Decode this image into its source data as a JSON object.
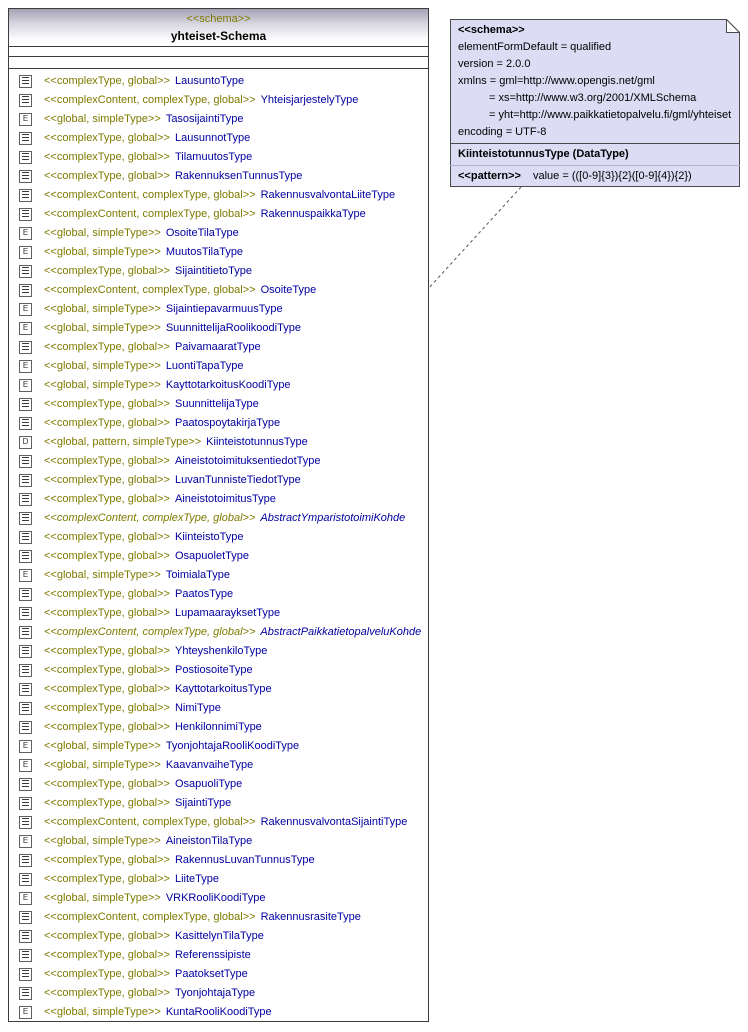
{
  "colors": {
    "stereotype_olive": "#7e7a00",
    "type_name_navy": "#0000a0",
    "note_background": "#dcdcf5",
    "header_gradient_top": "#a5a1b4"
  },
  "schema_box": {
    "stereotype": "<<schema>>",
    "title": "yhteiset-Schema",
    "rows": [
      {
        "icon": "complex",
        "icon_name": "complextype-icon",
        "glyph": "",
        "stereotype": "<<complexType, global>>",
        "name": "LausuntoType"
      },
      {
        "icon": "complex",
        "icon_name": "complextype-icon",
        "glyph": "",
        "stereotype": "<<complexContent, complexType, global>>",
        "name": "YhteisjarjestelyType"
      },
      {
        "icon": "enum",
        "icon_name": "enum-simpletype-icon",
        "glyph": "E",
        "stereotype": "<<global, simpleType>>",
        "name": "TasosijaintiType"
      },
      {
        "icon": "complex",
        "icon_name": "complextype-icon",
        "glyph": "",
        "stereotype": "<<complexType, global>>",
        "name": "LausunnotType"
      },
      {
        "icon": "complex",
        "icon_name": "complextype-icon",
        "glyph": "",
        "stereotype": "<<complexType, global>>",
        "name": "TilamuutosType"
      },
      {
        "icon": "complex",
        "icon_name": "complextype-icon",
        "glyph": "",
        "stereotype": "<<complexType, global>>",
        "name": "RakennuksenTunnusType"
      },
      {
        "icon": "complex",
        "icon_name": "complextype-icon",
        "glyph": "",
        "stereotype": "<<complexContent, complexType, global>>",
        "name": "RakennusvalvontaLiiteType"
      },
      {
        "icon": "complex",
        "icon_name": "complextype-icon",
        "glyph": "",
        "stereotype": "<<complexContent, complexType, global>>",
        "name": "RakennuspaikkaType"
      },
      {
        "icon": "enum",
        "icon_name": "enum-simpletype-icon",
        "glyph": "E",
        "stereotype": "<<global, simpleType>>",
        "name": "OsoiteTilaType"
      },
      {
        "icon": "enum",
        "icon_name": "enum-simpletype-icon",
        "glyph": "E",
        "stereotype": "<<global, simpleType>>",
        "name": "MuutosTilaType"
      },
      {
        "icon": "complex",
        "icon_name": "complextype-icon",
        "glyph": "",
        "stereotype": "<<complexType, global>>",
        "name": "SijaintitietoType"
      },
      {
        "icon": "complex",
        "icon_name": "complextype-icon",
        "glyph": "",
        "stereotype": "<<complexContent, complexType, global>>",
        "name": "OsoiteType"
      },
      {
        "icon": "enum",
        "icon_name": "enum-simpletype-icon",
        "glyph": "E",
        "stereotype": "<<global, simpleType>>",
        "name": "SijaintiepavarmuusType"
      },
      {
        "icon": "enum",
        "icon_name": "enum-simpletype-icon",
        "glyph": "E",
        "stereotype": "<<global, simpleType>>",
        "name": "SuunnittelijaRoolikoodiType"
      },
      {
        "icon": "complex",
        "icon_name": "complextype-icon",
        "glyph": "",
        "stereotype": "<<complexType, global>>",
        "name": "PaivamaaratType"
      },
      {
        "icon": "enum",
        "icon_name": "enum-simpletype-icon",
        "glyph": "E",
        "stereotype": "<<global, simpleType>>",
        "name": "LuontiTapaType"
      },
      {
        "icon": "enum",
        "icon_name": "enum-simpletype-icon",
        "glyph": "E",
        "stereotype": "<<global, simpleType>>",
        "name": "KayttotarkoitusKoodiType"
      },
      {
        "icon": "complex",
        "icon_name": "complextype-icon",
        "glyph": "",
        "stereotype": "<<complexType, global>>",
        "name": "SuunnittelijaType"
      },
      {
        "icon": "complex",
        "icon_name": "complextype-icon",
        "glyph": "",
        "stereotype": "<<complexType, global>>",
        "name": "PaatospoytakirjaType"
      },
      {
        "icon": "pattern",
        "icon_name": "pattern-simpletype-icon",
        "glyph": "D",
        "stereotype": "<<global, pattern, simpleType>>",
        "name": "KiinteistotunnusType"
      },
      {
        "icon": "complex",
        "icon_name": "complextype-icon",
        "glyph": "",
        "stereotype": "<<complexType, global>>",
        "name": "AineistotoimituksentiedotType"
      },
      {
        "icon": "complex",
        "icon_name": "complextype-icon",
        "glyph": "",
        "stereotype": "<<complexType, global>>",
        "name": "LuvanTunnisteTiedotType"
      },
      {
        "icon": "complex",
        "icon_name": "complextype-icon",
        "glyph": "",
        "stereotype": "<<complexType, global>>",
        "name": "AineistotoimitusType"
      },
      {
        "icon": "complex",
        "icon_name": "complextype-icon",
        "glyph": "",
        "stereotype": "<<complexContent, complexType, global>>",
        "name": "AbstractYmparistotoimiKohde",
        "abstract": true
      },
      {
        "icon": "complex",
        "icon_name": "complextype-icon",
        "glyph": "",
        "stereotype": "<<complexType, global>>",
        "name": "KiinteistoType"
      },
      {
        "icon": "complex",
        "icon_name": "complextype-icon",
        "glyph": "",
        "stereotype": "<<complexType, global>>",
        "name": "OsapuoletType"
      },
      {
        "icon": "enum",
        "icon_name": "enum-simpletype-icon",
        "glyph": "E",
        "stereotype": "<<global, simpleType>>",
        "name": "ToimialaType"
      },
      {
        "icon": "complex",
        "icon_name": "complextype-icon",
        "glyph": "",
        "stereotype": "<<complexType, global>>",
        "name": "PaatosType"
      },
      {
        "icon": "complex",
        "icon_name": "complextype-icon",
        "glyph": "",
        "stereotype": "<<complexType, global>>",
        "name": "LupamaarayksetType"
      },
      {
        "icon": "complex",
        "icon_name": "complextype-icon",
        "glyph": "",
        "stereotype": "<<complexContent, complexType, global>>",
        "name": "AbstractPaikkatietopalveluKohde",
        "abstract": true
      },
      {
        "icon": "complex",
        "icon_name": "complextype-icon",
        "glyph": "",
        "stereotype": "<<complexType, global>>",
        "name": "YhteyshenkiloType"
      },
      {
        "icon": "complex",
        "icon_name": "complextype-icon",
        "glyph": "",
        "stereotype": "<<complexType, global>>",
        "name": "PostiosoiteType"
      },
      {
        "icon": "complex",
        "icon_name": "complextype-icon",
        "glyph": "",
        "stereotype": "<<complexType, global>>",
        "name": "KayttotarkoitusType"
      },
      {
        "icon": "complex",
        "icon_name": "complextype-icon",
        "glyph": "",
        "stereotype": "<<complexType, global>>",
        "name": "NimiType"
      },
      {
        "icon": "complex",
        "icon_name": "complextype-icon",
        "glyph": "",
        "stereotype": "<<complexType, global>>",
        "name": "HenkilonnimiType"
      },
      {
        "icon": "enum",
        "icon_name": "enum-simpletype-icon",
        "glyph": "E",
        "stereotype": "<<global, simpleType>>",
        "name": "TyonjohtajaRooliKoodiType"
      },
      {
        "icon": "enum",
        "icon_name": "enum-simpletype-icon",
        "glyph": "E",
        "stereotype": "<<global, simpleType>>",
        "name": "KaavanvaiheType"
      },
      {
        "icon": "complex",
        "icon_name": "complextype-icon",
        "glyph": "",
        "stereotype": "<<complexType, global>>",
        "name": "OsapuoliType"
      },
      {
        "icon": "complex",
        "icon_name": "complextype-icon",
        "glyph": "",
        "stereotype": "<<complexType, global>>",
        "name": "SijaintiType"
      },
      {
        "icon": "complex",
        "icon_name": "complextype-icon",
        "glyph": "",
        "stereotype": "<<complexContent, complexType, global>>",
        "name": "RakennusvalvontaSijaintiType"
      },
      {
        "icon": "enum",
        "icon_name": "enum-simpletype-icon",
        "glyph": "E",
        "stereotype": "<<global, simpleType>>",
        "name": "AineistonTilaType"
      },
      {
        "icon": "complex",
        "icon_name": "complextype-icon",
        "glyph": "",
        "stereotype": "<<complexType, global>>",
        "name": "RakennusLuvanTunnusType"
      },
      {
        "icon": "complex",
        "icon_name": "complextype-icon",
        "glyph": "",
        "stereotype": "<<complexType, global>>",
        "name": "LiiteType"
      },
      {
        "icon": "enum",
        "icon_name": "enum-simpletype-icon",
        "glyph": "E",
        "stereotype": "<<global, simpleType>>",
        "name": "VRKRooliKoodiType"
      },
      {
        "icon": "complex",
        "icon_name": "complextype-icon",
        "glyph": "",
        "stereotype": "<<complexContent, complexType, global>>",
        "name": "RakennusrasiteType"
      },
      {
        "icon": "complex",
        "icon_name": "complextype-icon",
        "glyph": "",
        "stereotype": "<<complexType, global>>",
        "name": "KasittelynTilaType"
      },
      {
        "icon": "complex",
        "icon_name": "complextype-icon",
        "glyph": "",
        "stereotype": "<<complexType, global>>",
        "name": "Referenssipiste"
      },
      {
        "icon": "complex",
        "icon_name": "complextype-icon",
        "glyph": "",
        "stereotype": "<<complexType, global>>",
        "name": "PaatoksetType"
      },
      {
        "icon": "complex",
        "icon_name": "complextype-icon",
        "glyph": "",
        "stereotype": "<<complexType, global>>",
        "name": "TyonjohtajaType"
      },
      {
        "icon": "enum",
        "icon_name": "enum-simpletype-icon",
        "glyph": "E",
        "stereotype": "<<global, simpleType>>",
        "name": "KuntaRooliKoodiType"
      }
    ]
  },
  "note": {
    "stereotype": "<<schema>>",
    "attributes": [
      {
        "text": "elementFormDefault = qualified"
      },
      {
        "text": "version = 2.0.0"
      },
      {
        "text": "xmlns = gml=http://www.opengis.net/gml"
      },
      {
        "text": "= xs=http://www.w3.org/2001/XMLSchema",
        "indent": true
      },
      {
        "text": "= yht=http://www.paikkatietopalvelu.fi/gml/yhteiset",
        "indent": true
      },
      {
        "text": "encoding = UTF-8"
      }
    ],
    "datatype_title": "KiinteistotunnusType (DataType)",
    "pattern_label": "<<pattern>>",
    "pattern_value": "value = (([0-9]{3}){2}([0-9]{4}){2})"
  }
}
